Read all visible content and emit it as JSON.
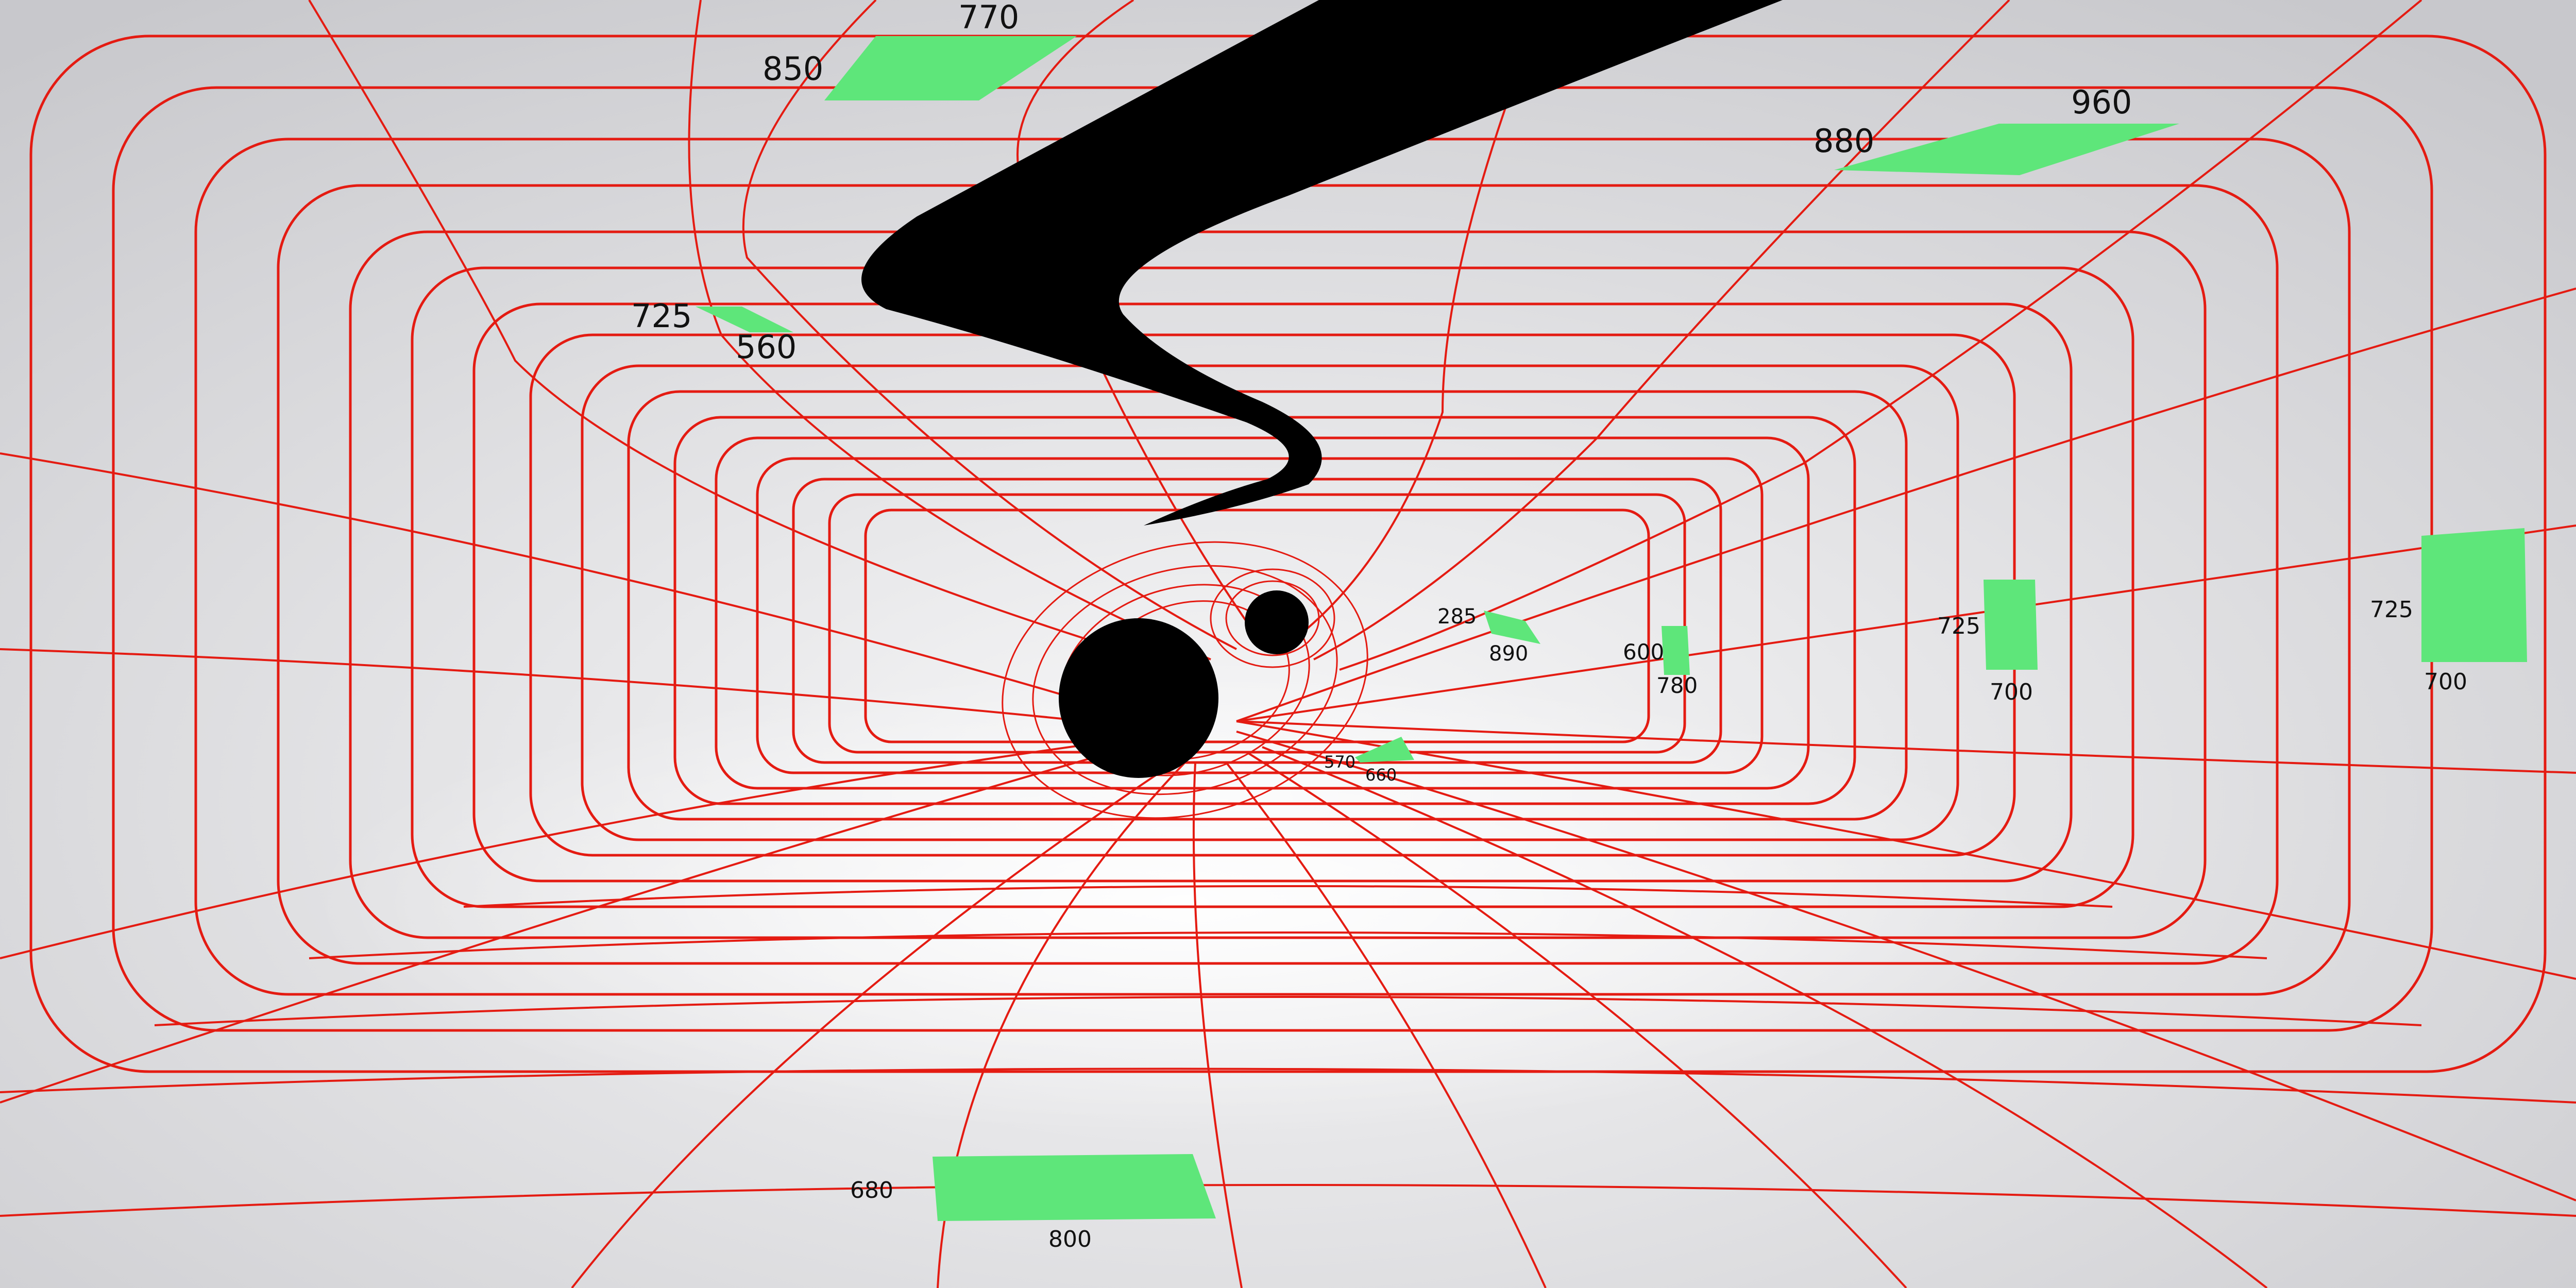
{
  "colors": {
    "background_center": "#f7f7f8",
    "background_edge": "#c9c9cd",
    "grid": "#e41b12",
    "patch": "#5ee67a",
    "void": "#000000"
  },
  "patches": [
    {
      "id": "top-left-a",
      "labels": [
        "850",
        "770"
      ]
    },
    {
      "id": "top-right",
      "labels": [
        "880",
        "960"
      ]
    },
    {
      "id": "upper-left-small",
      "labels": [
        "725",
        "560"
      ]
    },
    {
      "id": "center-1",
      "labels": [
        "285",
        "890"
      ]
    },
    {
      "id": "center-2",
      "labels": [
        "600",
        "780"
      ]
    },
    {
      "id": "center-3",
      "labels": [
        "570",
        "660"
      ]
    },
    {
      "id": "right-1",
      "labels": [
        "725",
        "700"
      ]
    },
    {
      "id": "right-edge",
      "labels": [
        "725",
        "700"
      ]
    },
    {
      "id": "bottom",
      "labels": [
        "680",
        "800"
      ]
    }
  ]
}
